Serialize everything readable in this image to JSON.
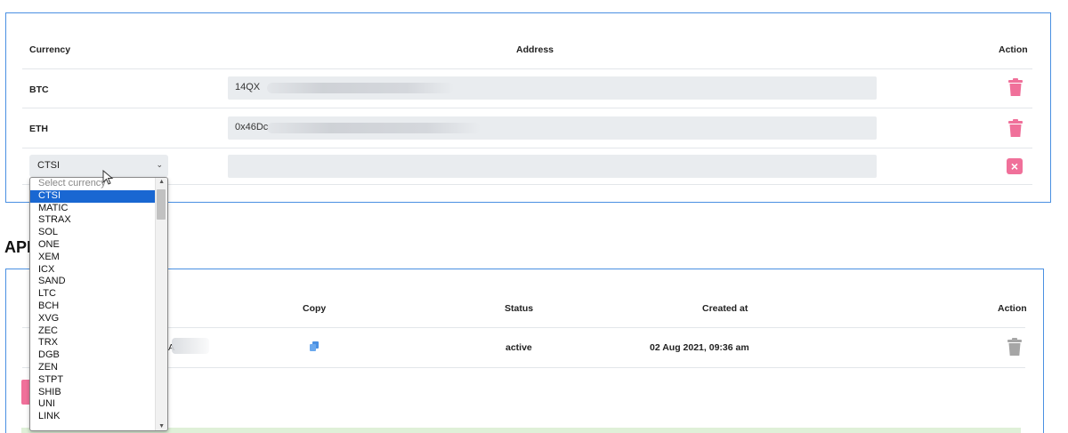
{
  "wallets": {
    "headers": {
      "currency": "Currency",
      "address": "Address",
      "action": "Action"
    },
    "rows": [
      {
        "currency": "BTC",
        "address": "14QX"
      },
      {
        "currency": "ETH",
        "address": "0x46Dc"
      }
    ],
    "new_row": {
      "selected_currency": "CTSI",
      "address": ""
    }
  },
  "currency_dropdown": {
    "placeholder": "Select currency",
    "selected": "CTSI",
    "options": [
      "CTSI",
      "MATIC",
      "STRAX",
      "SOL",
      "ONE",
      "XEM",
      "ICX",
      "SAND",
      "LTC",
      "BCH",
      "XVG",
      "ZEC",
      "TRX",
      "DGB",
      "ZEN",
      "STPT",
      "SHIB",
      "UNI",
      "LINK"
    ]
  },
  "api": {
    "title": "API",
    "headers": {
      "copy": "Copy",
      "status": "Status",
      "created_at": "Created at",
      "action": "Action"
    },
    "rows": [
      {
        "key_fragment": "A",
        "status": "active",
        "created_at": "02 Aug 2021, 09:36 am"
      }
    ]
  },
  "colors": {
    "panel_border": "#4a90e2",
    "delete_pink": "#f0709a",
    "delete_gray": "#a6a6a6",
    "selected_option": "#1967d2",
    "copy_blue": "#4a90e2"
  },
  "icons": {
    "delete": "trash-icon",
    "remove": "x-icon",
    "copy": "copy-icon"
  }
}
